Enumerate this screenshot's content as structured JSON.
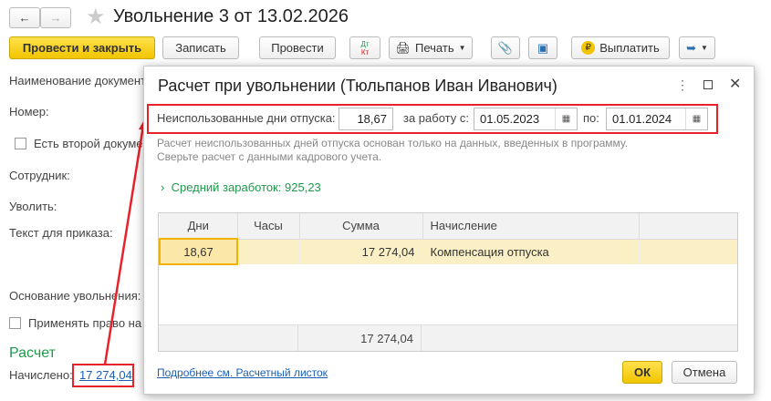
{
  "header": {
    "title": "Увольнение 3 от 13.02.2026"
  },
  "toolbar": {
    "post_close": "Провести и закрыть",
    "save": "Записать",
    "post": "Провести",
    "dt": "Дт",
    "kt": "Кт",
    "print": "Печать",
    "pay": "Выплатить"
  },
  "form": {
    "doc_name_label": "Наименование документ",
    "number_label": "Номер:",
    "second_doc_label": "Есть второй докуме",
    "employee_label": "Сотрудник:",
    "dismiss_label": "Уволить:",
    "order_text_label": "Текст для приказа:",
    "reason_label": "Основание увольнения:",
    "apply_right_label": "Применять право на",
    "calc_heading": "Расчет",
    "accrued_label": "Начислено:",
    "accrued_value": "17 274,04"
  },
  "dialog": {
    "title": "Расчет при увольнении (Тюльпанов Иван Иванович)",
    "unused_days_label": "Неиспользованные дни отпуска:",
    "unused_days_value": "18,67",
    "work_from_label": "за работу с:",
    "work_from_value": "01.05.2023",
    "to_label": "по:",
    "to_value": "01.01.2024",
    "note_line1": "Расчет неиспользованных дней отпуска основан только на данных, введенных в программу.",
    "note_line2": "Сверьте расчет с данными кадрового учета.",
    "avg_earnings": "Средний заработок: 925,23",
    "table": {
      "columns": [
        "Дни",
        "Часы",
        "Сумма",
        "Начисление",
        ""
      ],
      "rows": [
        {
          "days": "18,67",
          "hours": "",
          "sum": "17 274,04",
          "accrual": "Компенсация отпуска"
        }
      ],
      "total_sum": "17 274,04"
    },
    "details_link": "Подробнее см. Расчетный листок",
    "ok": "ОК",
    "cancel": "Отмена"
  },
  "colors": {
    "accent_yellow": "#f2c500",
    "highlight_red": "#e8222c",
    "green": "#1c9a4a",
    "selected_row": "#fbf0c5"
  }
}
